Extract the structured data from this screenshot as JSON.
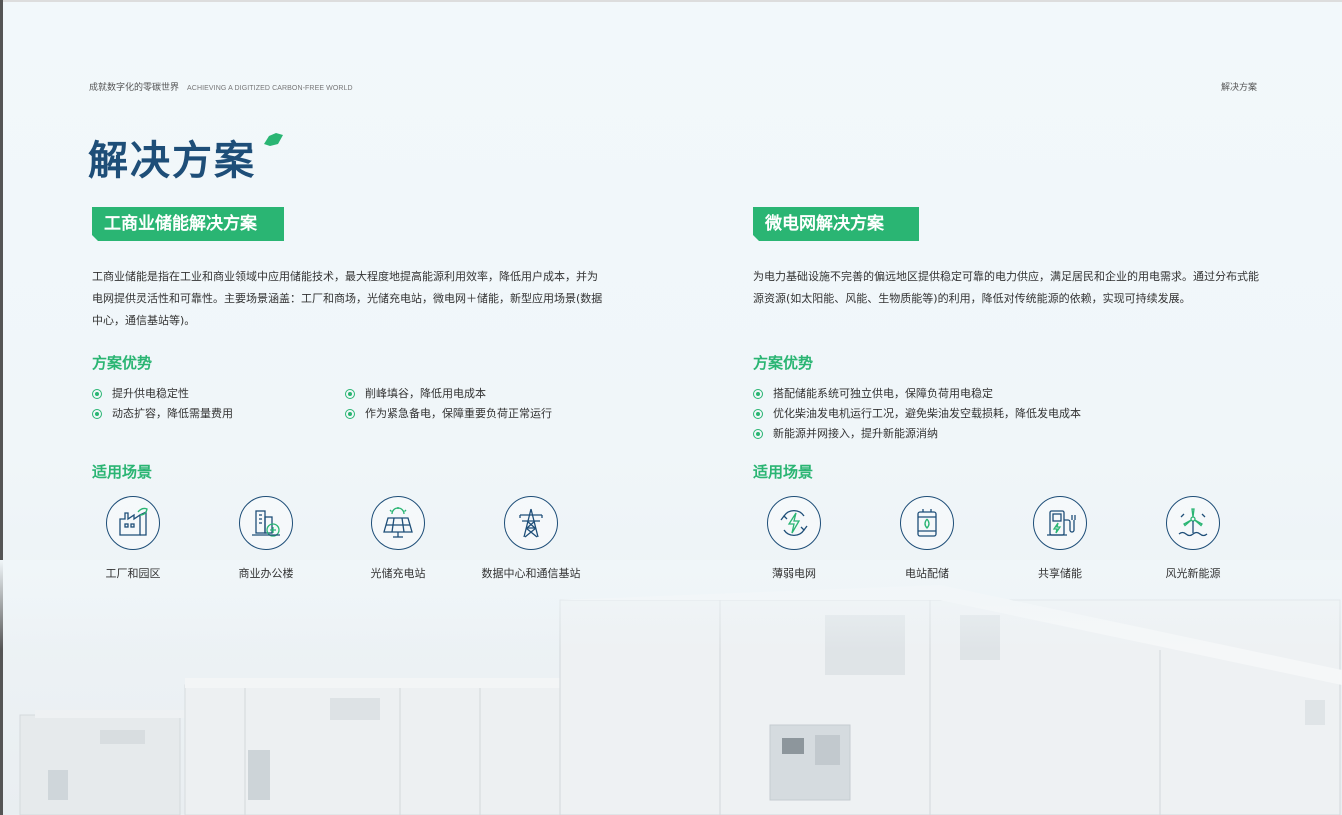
{
  "header": {
    "tagline_cn": "成就数字化的零碳世界",
    "tagline_en": "ACHIEVING A DIGITIZED CARBON-FREE WORLD",
    "section": "解决方案"
  },
  "page_title": "解决方案",
  "colors": {
    "accent_green": "#2ab573",
    "title_blue": "#1e4e78"
  },
  "left": {
    "pill": "工商业储能解决方案",
    "description": "工商业储能是指在工业和商业领域中应用储能技术，最大程度地提高能源利用效率，降低用户成本，并为电网提供灵活性和可靠性。主要场景涵盖：工厂和商场，光储充电站，微电网＋储能，新型应用场景(数据中心，通信基站等)。",
    "advantages_heading": "方案优势",
    "advantages": [
      "提升供电稳定性",
      "削峰填谷，降低用电成本",
      "动态扩容，降低需量费用",
      "作为紧急备电，保障重要负荷正常运行"
    ],
    "scenes_heading": "适用场景",
    "scenes": [
      {
        "label": "工厂和园区",
        "icon": "factory-icon"
      },
      {
        "label": "商业办公楼",
        "icon": "office-building-icon"
      },
      {
        "label": "光储充电站",
        "icon": "solar-panel-icon"
      },
      {
        "label": "数据中心和通信基站",
        "icon": "transmission-tower-icon"
      }
    ]
  },
  "right": {
    "pill": "微电网解决方案",
    "description": "为电力基础设施不完善的偏远地区提供稳定可靠的电力供应，满足居民和企业的用电需求。通过分布式能源资源(如太阳能、风能、生物质能等)的利用，降低对传统能源的依赖，实现可持续发展。",
    "advantages_heading": "方案优势",
    "advantages": [
      "搭配储能系统可独立供电，保障负荷用电稳定",
      "优化柴油发电机运行工况，避免柴油发空载损耗，降低发电成本",
      "新能源并网接入，提升新能源消纳"
    ],
    "scenes_heading": "适用场景",
    "scenes": [
      {
        "label": "薄弱电网",
        "icon": "weak-grid-icon"
      },
      {
        "label": "电站配储",
        "icon": "power-station-storage-icon"
      },
      {
        "label": "共享储能",
        "icon": "shared-charging-icon"
      },
      {
        "label": "风光新能源",
        "icon": "wind-turbine-icon"
      }
    ]
  }
}
